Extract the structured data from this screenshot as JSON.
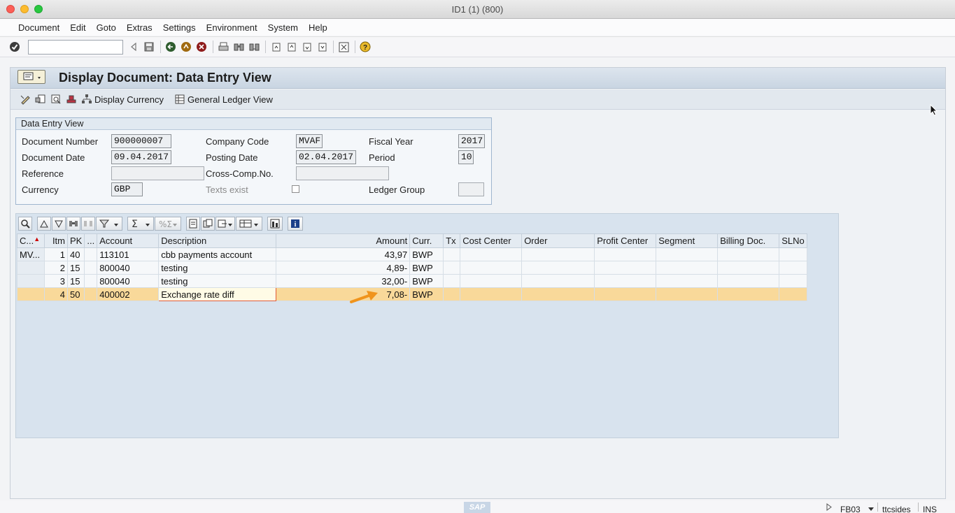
{
  "window": {
    "title": "ID1 (1) (800)"
  },
  "menu": [
    "Document",
    "Edit",
    "Goto",
    "Extras",
    "Settings",
    "Environment",
    "System",
    "Help"
  ],
  "page": {
    "title": "Display Document: Data Entry View"
  },
  "app_toolbar": {
    "display_currency": "Display Currency",
    "general_ledger_view": "General Ledger View"
  },
  "group": {
    "title": "Data Entry View",
    "document_number": {
      "label": "Document Number",
      "value": "900000007"
    },
    "company_code": {
      "label": "Company Code",
      "value": "MVAF"
    },
    "fiscal_year": {
      "label": "Fiscal Year",
      "value": "2017"
    },
    "document_date": {
      "label": "Document Date",
      "value": "09.04.2017"
    },
    "posting_date": {
      "label": "Posting Date",
      "value": "02.04.2017"
    },
    "period": {
      "label": "Period",
      "value": "10"
    },
    "reference": {
      "label": "Reference",
      "value": ""
    },
    "cross_comp": {
      "label": "Cross-Comp.No.",
      "value": ""
    },
    "currency": {
      "label": "Currency",
      "value": "GBP"
    },
    "texts_exist": {
      "label": "Texts exist"
    },
    "ledger_group": {
      "label": "Ledger Group",
      "value": ""
    }
  },
  "grid": {
    "columns": [
      "C...",
      "Itm",
      "PK",
      "...",
      "Account",
      "Description",
      "Amount",
      "Curr.",
      "Tx",
      "Cost Center",
      "Order",
      "Profit Center",
      "Segment",
      "Billing Doc.",
      "SLNo"
    ],
    "rows": [
      {
        "c": "MV...",
        "itm": "1",
        "pk": "40",
        "account": "113101",
        "description": "cbb payments account",
        "amount": "43,97",
        "curr": "BWP"
      },
      {
        "c": "",
        "itm": "2",
        "pk": "15",
        "account": "800040",
        "description": "testing",
        "amount": "4,89-",
        "curr": "BWP"
      },
      {
        "c": "",
        "itm": "3",
        "pk": "15",
        "account": "800040",
        "description": "testing",
        "amount": "32,00-",
        "curr": "BWP"
      },
      {
        "c": "",
        "itm": "4",
        "pk": "50",
        "account": "400002",
        "description": "Exchange rate diff",
        "amount": "7,08-",
        "curr": "BWP"
      }
    ],
    "selected_row": 3
  },
  "status": {
    "logo": "SAP",
    "tcode": "FB03",
    "server": "ttcsides",
    "mode": "INS"
  },
  "colors": {
    "header_bg": "#c9d5e2",
    "selected_row": "#f9d99a",
    "arrow": "#f0941c"
  },
  "icons": [
    "check-icon",
    "back-icon",
    "exit-icon",
    "cancel-icon",
    "print-icon",
    "find-icon",
    "help-icon",
    "layout-menu-icon"
  ]
}
